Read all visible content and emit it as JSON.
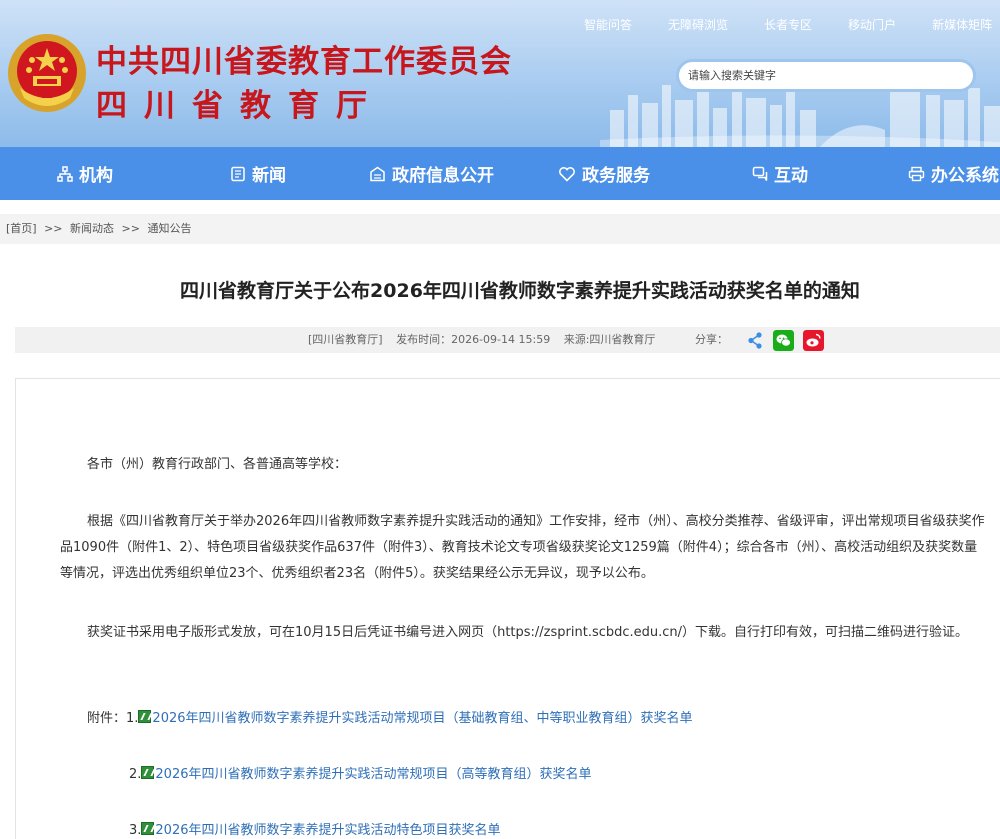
{
  "header": {
    "title_org": "中共四川省委教育工作委员会",
    "title_dept": "四川省教育厅",
    "top_links": [
      "智能问答",
      "无障碍浏览",
      "长者专区",
      "移动门户",
      "新媒体矩阵"
    ],
    "search_placeholder": "请输入搜索关键字"
  },
  "nav": {
    "items": [
      {
        "label": "机构",
        "icon": "org-chart-icon"
      },
      {
        "label": "新闻",
        "icon": "news-icon"
      },
      {
        "label": "政府信息公开",
        "icon": "info-disclosure-icon"
      },
      {
        "label": "政务服务",
        "icon": "heart-service-icon"
      },
      {
        "label": "互动",
        "icon": "chat-icon"
      },
      {
        "label": "办公系统",
        "icon": "printer-icon"
      }
    ]
  },
  "breadcrumb": {
    "home": "[首页]",
    "sep": ">>",
    "level1": "新闻动态",
    "level2": "通知公告"
  },
  "article": {
    "title": "四川省教育厅关于公布2026年四川省教师数字素养提升实践活动获奖名单的通知",
    "source_tag": "[四川省教育厅]",
    "published": "发布时间：2026-09-14 15:59",
    "source": "来源:四川省教育厅",
    "share_label": "分享：",
    "salutation": "各市（州）教育行政部门、各普通高等学校：",
    "para1": "根据《四川省教育厅关于举办2026年四川省教师数字素养提升实践活动的通知》工作安排，经市（州）、高校分类推荐、省级评审，评出常规项目省级获奖作品1090件（附件1、2）、特色项目省级获奖作品637件（附件3）、教育技术论文专项省级获奖论文1259篇（附件4）；综合各市（州）、高校活动组织及获奖数量等情况，评选出优秀组织单位23个、优秀组织者23名（附件5）。获奖结果经公示无异议，现予以公布。",
    "para2": "获奖证书采用电子版形式发放，可在10月15日后凭证书编号进入网页（https://zsprint.scbdc.edu.cn/）下载。自行打印有效，可扫描二维码进行验证。",
    "attach_label": "附件：",
    "attachments": [
      {
        "num": "1.",
        "title": "2026年四川省教师数字素养提升实践活动常规项目（基础教育组、中等职业教育组）获奖名单"
      },
      {
        "num": "2.",
        "title": "2026年四川省教师数字素养提升实践活动常规项目（高等教育组）获奖名单"
      },
      {
        "num": "3.",
        "title": "2026年四川省教师数字素养提升实践活动特色项目获奖名单"
      }
    ]
  },
  "colors": {
    "nav_bg": "#4a8fe8",
    "title_red": "#c8161d",
    "link_blue": "#2e6fb8",
    "wechat_green": "#1aad19",
    "weibo_red": "#e6162d",
    "share_blue": "#3a8ee6"
  }
}
